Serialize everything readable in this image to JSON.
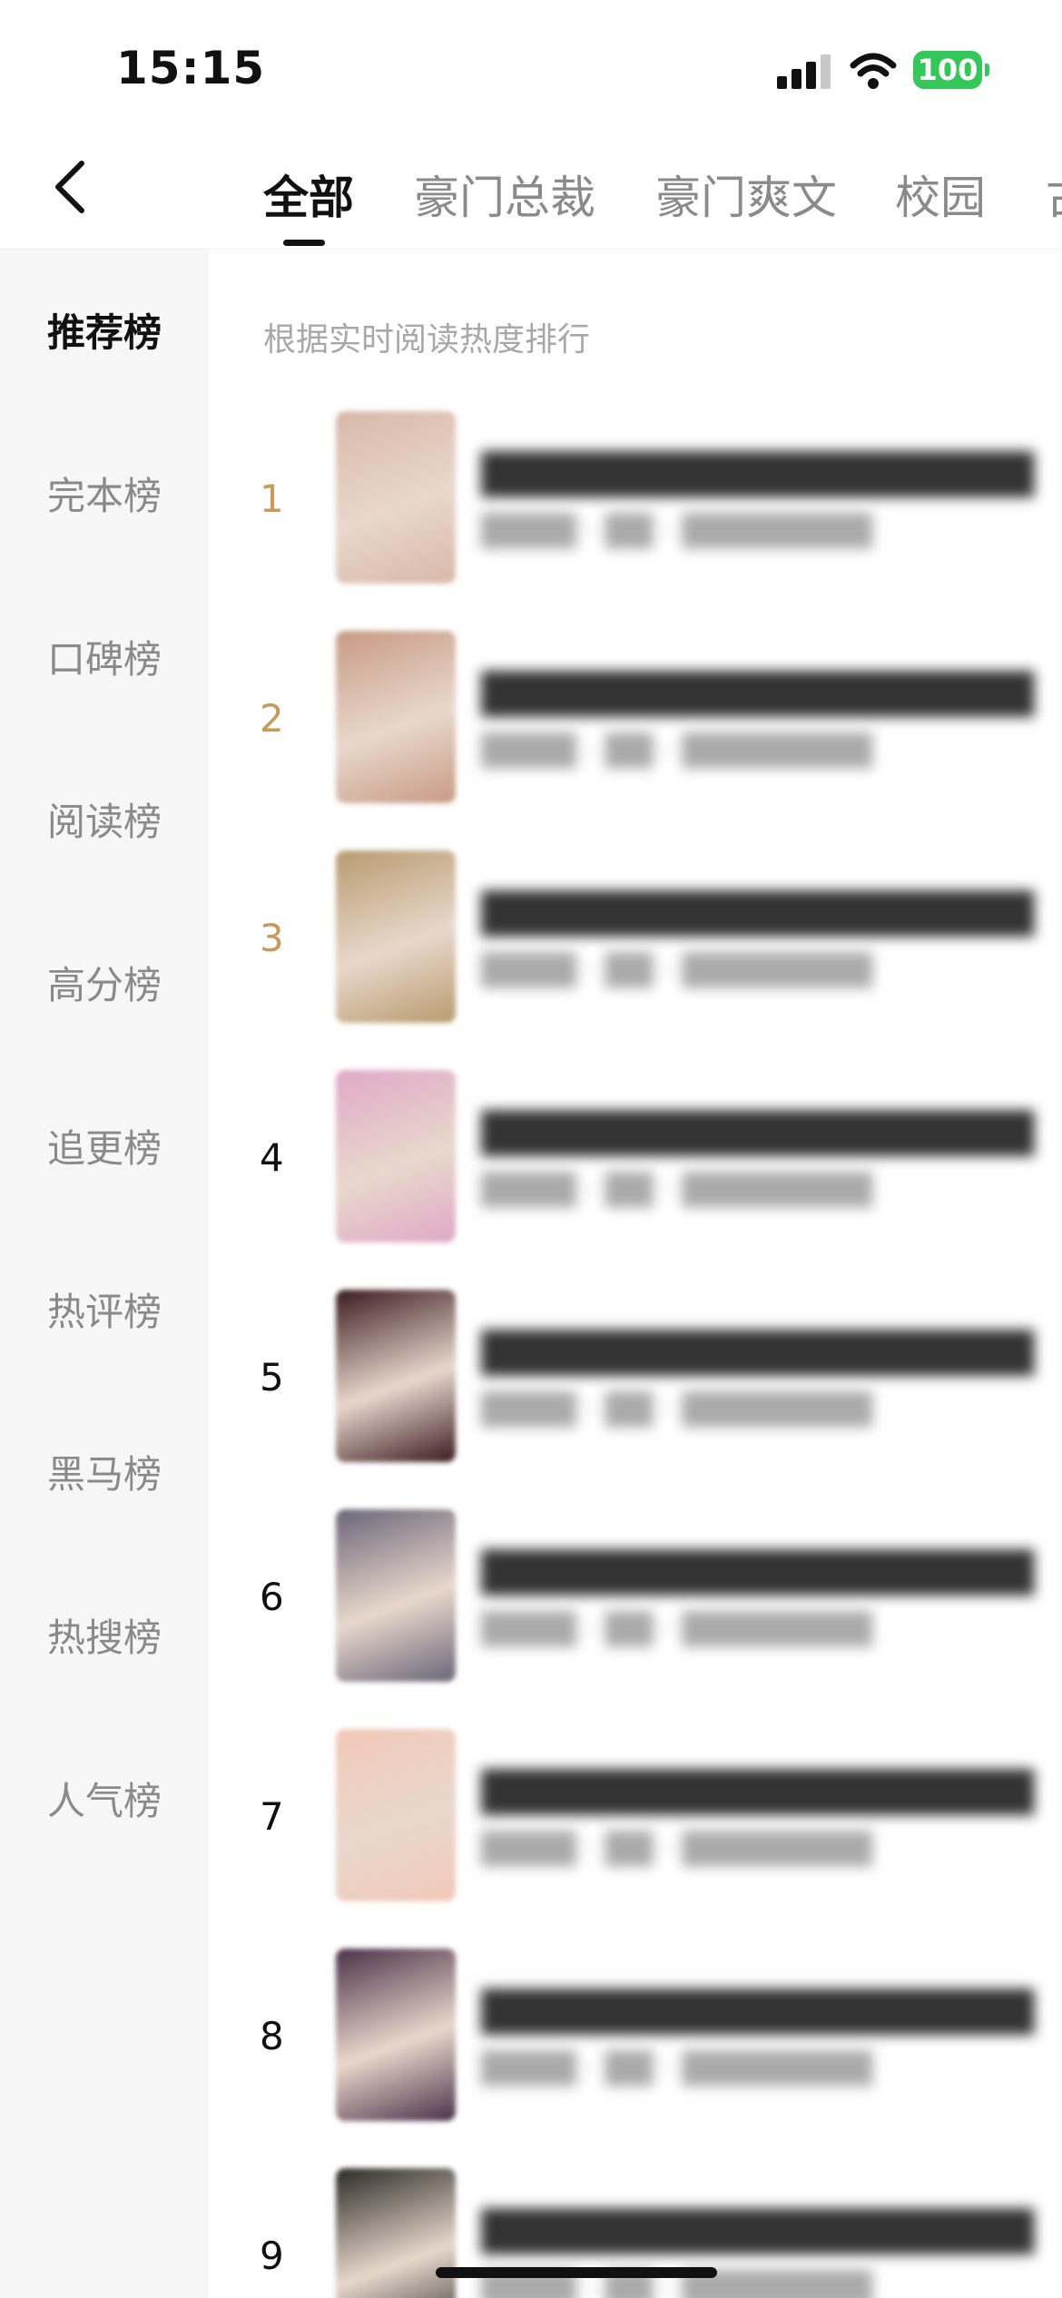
{
  "status_bar": {
    "time": "15:15",
    "battery": "100"
  },
  "header": {
    "tabs": [
      {
        "label": "全部",
        "active": true
      },
      {
        "label": "豪门总裁",
        "active": false
      },
      {
        "label": "豪门爽文",
        "active": false
      },
      {
        "label": "校园",
        "active": false
      },
      {
        "label": "古",
        "active": false
      }
    ]
  },
  "sidebar": {
    "items": [
      {
        "label": "推荐榜",
        "active": true
      },
      {
        "label": "完本榜",
        "active": false
      },
      {
        "label": "口碑榜",
        "active": false
      },
      {
        "label": "阅读榜",
        "active": false
      },
      {
        "label": "高分榜",
        "active": false
      },
      {
        "label": "追更榜",
        "active": false
      },
      {
        "label": "热评榜",
        "active": false
      },
      {
        "label": "黑马榜",
        "active": false
      },
      {
        "label": "热搜榜",
        "active": false
      },
      {
        "label": "人气榜",
        "active": false
      }
    ]
  },
  "main": {
    "subtitle": "根据实时阅读热度排行",
    "books": [
      {
        "rank": "1",
        "top": true,
        "cover_color": "#d8b8a8"
      },
      {
        "rank": "2",
        "top": true,
        "cover_color": "#c89a84"
      },
      {
        "rank": "3",
        "top": true,
        "cover_color": "#b89a6e"
      },
      {
        "rank": "4",
        "top": false,
        "cover_color": "#e0a8c8"
      },
      {
        "rank": "5",
        "top": false,
        "cover_color": "#3a1a1e"
      },
      {
        "rank": "6",
        "top": false,
        "cover_color": "#6a6478"
      },
      {
        "rank": "7",
        "top": false,
        "cover_color": "#f2c8b8"
      },
      {
        "rank": "8",
        "top": false,
        "cover_color": "#4a3048"
      },
      {
        "rank": "9",
        "top": false,
        "cover_color": "#2a2a24"
      }
    ]
  },
  "colors": {
    "accent_rank": "#c79a5a",
    "sidebar_bg": "#f7f7f7"
  }
}
